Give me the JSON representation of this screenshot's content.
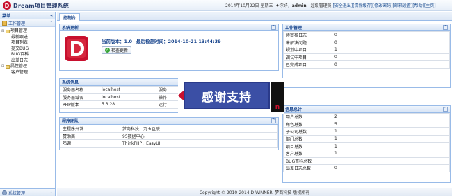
{
  "header": {
    "logo_letter": "D",
    "app_title": "Dream项目管理系统",
    "date": "2014年10月22日 星期三",
    "greeting": "你好，",
    "username": "admin",
    "role": " - 超级管理员",
    "links": [
      "[安全退出]",
      "[清除缓存]",
      "[修改密码]",
      "[邮箱设置]",
      "[帮助]",
      "[主页]"
    ]
  },
  "sidebar": {
    "title": "菜单",
    "collapse_icon": "«",
    "section_title": "工作管理",
    "tree": [
      {
        "label": "项目管理",
        "children": [
          "最新跟进",
          "项目列表",
          "提交BUG",
          "BUG百科",
          "出差日志"
        ]
      },
      {
        "label": "属性管理",
        "children": [
          "客户管理"
        ]
      }
    ],
    "footer_title": "系统管理"
  },
  "tabs": [
    "控制台"
  ],
  "system_update": {
    "title": "系统更新",
    "logo_letter": "D",
    "version_label": "当前版本：1.0",
    "last_check": "最后检测时间：2014-10-21 13:44:39",
    "check_button": "检查更新"
  },
  "system_info": {
    "title": "系统信息",
    "rows": [
      [
        "服务器名称",
        "localhost",
        "服务",
        ""
      ],
      [
        "服务器域名",
        "localhost",
        "操作",
        ""
      ],
      [
        "PHP版本",
        "5.3.28",
        "运行",
        ""
      ]
    ]
  },
  "dev_team": {
    "title": "程序团队",
    "rows": [
      [
        "主程序开发",
        "梦商科技，九五互联"
      ],
      [
        "赞助商",
        "95数据中心"
      ],
      [
        "鸣谢",
        "ThinkPHP，EasyUI"
      ]
    ]
  },
  "work_management": {
    "title": "工作管理",
    "rows": [
      [
        "待审核日志",
        "0"
      ],
      [
        "未解决问题",
        "0"
      ],
      [
        "规划中项目",
        "1"
      ],
      [
        "调试中项目",
        "0"
      ],
      [
        "已完成项目",
        "0"
      ]
    ]
  },
  "info_stats": {
    "title": "信息总计",
    "rows": [
      [
        "用户总数",
        "2"
      ],
      [
        "角色总数",
        "5"
      ],
      [
        "子公司总数",
        "1"
      ],
      [
        "部门总数",
        "1"
      ],
      [
        "项目总数",
        "1"
      ],
      [
        "客户总数",
        "1"
      ],
      [
        "BUG百科总数",
        ""
      ],
      [
        "出差日志总数",
        "0"
      ]
    ]
  },
  "overlay": {
    "text": "感谢支持",
    "side_text": "n"
  },
  "footer": {
    "copyright": "Copyright © 2010-2014 D-WINNER. 梦商科技 版权所有"
  },
  "colors": {
    "accent": "#15428b",
    "border": "#99bbe8",
    "brand_red": "#c8102e",
    "overlay_blue": "#3b4fa5"
  }
}
